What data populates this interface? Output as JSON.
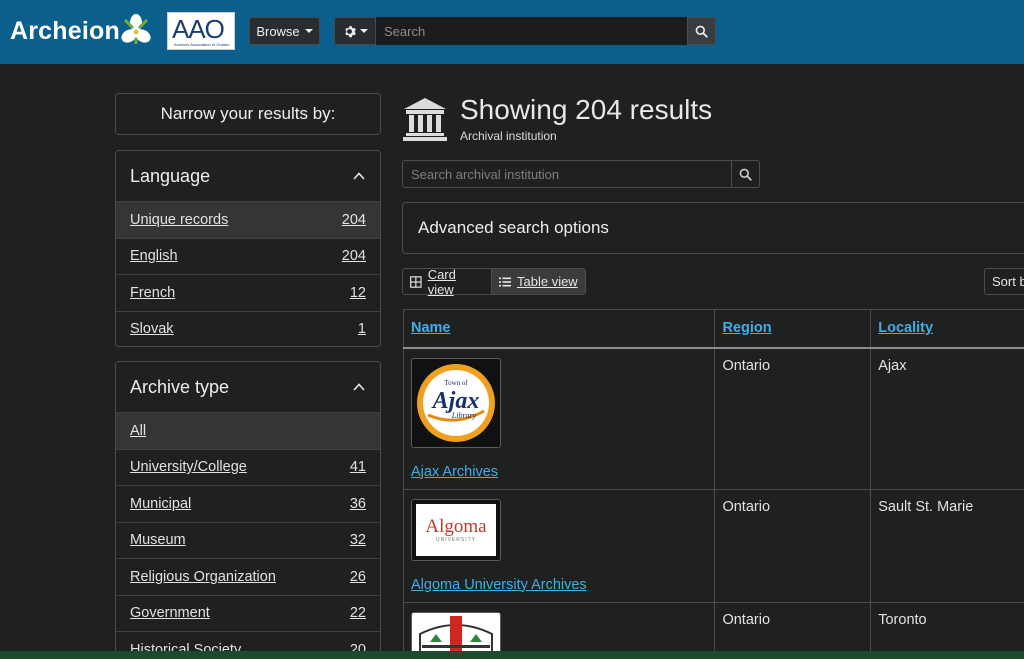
{
  "header": {
    "brand": "Archeion",
    "partner_logo_text": "AAO",
    "partner_logo_subtext": "Archives Association of Ontario",
    "browse_label": "Browse",
    "search_placeholder": "Search"
  },
  "sidebar": {
    "narrow_title": "Narrow your results by:",
    "facets": [
      {
        "title": "Language",
        "items": [
          {
            "label": "Unique records",
            "count": "204",
            "active": true
          },
          {
            "label": "English",
            "count": "204"
          },
          {
            "label": "French",
            "count": "12"
          },
          {
            "label": "Slovak",
            "count": "1"
          }
        ]
      },
      {
        "title": "Archive type",
        "items": [
          {
            "label": "All",
            "count": "",
            "active": true
          },
          {
            "label": "University/College",
            "count": "41"
          },
          {
            "label": "Municipal",
            "count": "36"
          },
          {
            "label": "Museum",
            "count": "32"
          },
          {
            "label": "Religious Organization",
            "count": "26"
          },
          {
            "label": "Government",
            "count": "22"
          },
          {
            "label": "Historical Society",
            "count": "20"
          }
        ]
      }
    ]
  },
  "main": {
    "title": "Showing 204 results",
    "subtitle": "Archival institution",
    "search_placeholder": "Search archival institution",
    "advanced_label": "Advanced search options",
    "card_view_label": "Card view",
    "table_view_label": "Table view",
    "sort_label": "Sort b",
    "table": {
      "headers": [
        "Name",
        "Region",
        "Locality"
      ],
      "rows": [
        {
          "name": "Ajax Archives",
          "region": "Ontario",
          "locality": "Ajax",
          "logo_text": "Ajax",
          "logo_small_top": "Town of",
          "logo_small_bottom": "Library"
        },
        {
          "name": "Algoma University Archives",
          "region": "Ontario",
          "locality": "Sault St. Marie",
          "logo_text": "Algoma",
          "logo_small_bottom": "UNIVERSITY"
        },
        {
          "name": "",
          "region": "Ontario",
          "locality": "Toronto"
        }
      ]
    }
  },
  "colors": {
    "header_bg": "#0b5f8c",
    "page_bg": "#1f2020",
    "link": "#3db0ec"
  }
}
